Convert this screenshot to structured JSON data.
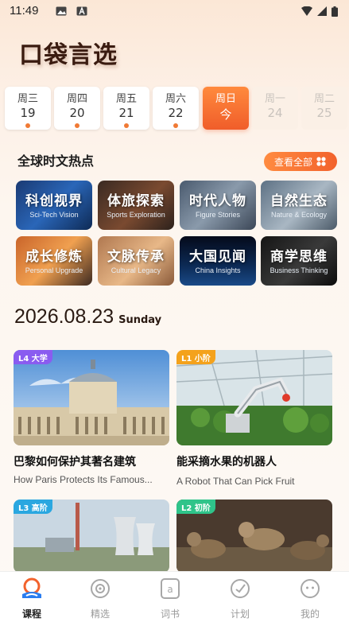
{
  "status": {
    "time": "11:49"
  },
  "app": {
    "logo": "口袋言选"
  },
  "week": [
    {
      "name": "周三",
      "num": "19",
      "state": "done"
    },
    {
      "name": "周四",
      "num": "20",
      "state": "done"
    },
    {
      "name": "周五",
      "num": "21",
      "state": "done"
    },
    {
      "name": "周六",
      "num": "22",
      "state": "done"
    },
    {
      "name": "周日",
      "num": "今",
      "state": "active"
    },
    {
      "name": "周一",
      "num": "24",
      "state": "future"
    },
    {
      "name": "周二",
      "num": "25",
      "state": "future"
    }
  ],
  "hot": {
    "title": "全球时文热点",
    "view_all": "查看全部",
    "topics": [
      {
        "name": "科创视界",
        "sub": "Sci-Tech Vision"
      },
      {
        "name": "体旅探索",
        "sub": "Sports Exploration"
      },
      {
        "name": "时代人物",
        "sub": "Figure Stories"
      },
      {
        "name": "自然生态",
        "sub": "Nature & Ecology"
      },
      {
        "name": "成长修炼",
        "sub": "Personal Upgrade"
      },
      {
        "name": "文脉传承",
        "sub": "Cultural Legacy"
      },
      {
        "name": "大国见闻",
        "sub": "China Insights"
      },
      {
        "name": "商学思维",
        "sub": "Business Thinking"
      }
    ]
  },
  "feed": {
    "date": "2026.08.23",
    "weekday": "Sunday",
    "articles": [
      {
        "badge": "L4 大学",
        "badge_color": "#8a5cf0",
        "title": "巴黎如何保护其著名建筑",
        "subtitle": "How Paris Protects Its Famous..."
      },
      {
        "badge": "L1 小阶",
        "badge_color": "#f4a21c",
        "title": "能采摘水果的机器人",
        "subtitle": "A Robot That Can Pick Fruit"
      },
      {
        "badge": "L3 高阶",
        "badge_color": "#2aa7e0",
        "title": "",
        "subtitle": ""
      },
      {
        "badge": "L2 初阶",
        "badge_color": "#2fc48a",
        "title": "",
        "subtitle": ""
      }
    ]
  },
  "tabs": [
    {
      "label": "课程",
      "icon": "course-icon",
      "active": true
    },
    {
      "label": "精选",
      "icon": "featured-icon",
      "active": false
    },
    {
      "label": "词书",
      "icon": "wordbook-icon",
      "active": false
    },
    {
      "label": "计划",
      "icon": "plan-icon",
      "active": false
    },
    {
      "label": "我的",
      "icon": "profile-icon",
      "active": false
    }
  ],
  "colors": {
    "accent": "#f2622c",
    "accent_light": "#ff8b40"
  }
}
